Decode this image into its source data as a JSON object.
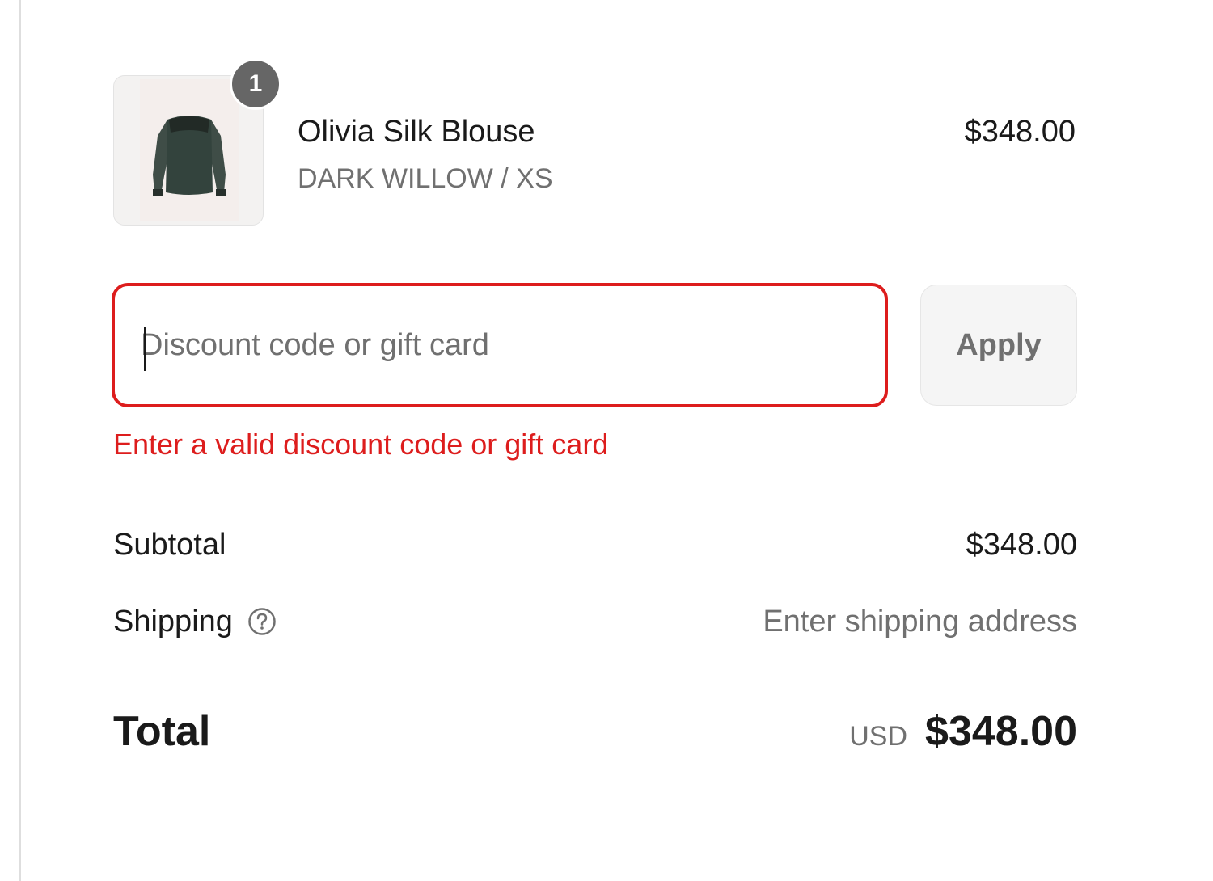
{
  "order_summary": {
    "line_item": {
      "quantity": "1",
      "name": "Olivia Silk Blouse",
      "variant": "DARK WILLOW / XS",
      "price": "$348.00",
      "thumbnail_icon": "blouse-image"
    },
    "discount": {
      "placeholder": "Discount code or gift card",
      "value": "",
      "apply_label": "Apply",
      "error": "Enter a valid discount code or gift card"
    },
    "subtotal": {
      "label": "Subtotal",
      "value": "$348.00"
    },
    "shipping": {
      "label": "Shipping",
      "value": "Enter shipping address",
      "help_icon": "question-circle-icon"
    },
    "total": {
      "label": "Total",
      "currency": "USD",
      "value": "$348.00"
    }
  },
  "colors": {
    "error": "#dd1d1d",
    "muted_text": "#707070",
    "badge": "#666666"
  }
}
